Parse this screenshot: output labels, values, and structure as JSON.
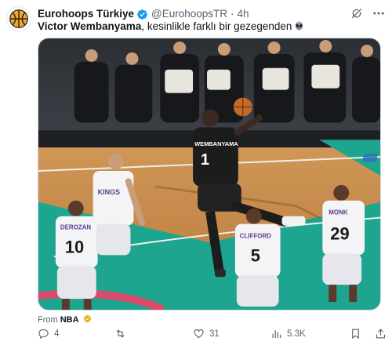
{
  "colors": {
    "verified": "#1d9bf0",
    "text_primary": "#0f1419",
    "text_secondary": "#536471",
    "court_teal": "#1ea58f",
    "court_wood": "#c98b4a",
    "spurs_black": "#1c1c1c",
    "kings_purple": "#5b3d8f"
  },
  "post": {
    "author": {
      "display_name": "Eurohoops Türkiye",
      "handle": "@EurohoopsTR",
      "separator": "·",
      "timestamp": "4h",
      "verified": true,
      "avatar_icon": "eurohoops-logo"
    },
    "text": {
      "mention": "Victor Wembanyama",
      "body": ", kesinlikle farklı bir gezegenden",
      "emoji_icon": "alien-icon"
    },
    "media": {
      "type": "video",
      "jersey_numbers": [
        "1",
        "10",
        "5",
        "29"
      ],
      "jersey_names": [
        "WEMBANYAMA",
        "DEROZAN",
        "CLIFFORD",
        "MONK"
      ],
      "jersey_team": "KINGS"
    },
    "source": {
      "prefix": "From",
      "org": "NBA",
      "badge_icon": "gold-verified-icon"
    },
    "actions": {
      "reply_count": "4",
      "repost_count": "",
      "like_count": "31",
      "views_count": "5.3K"
    },
    "icons": {
      "grok": "grok-icon",
      "more": "more-icon",
      "reply": "reply-icon",
      "repost": "repost-icon",
      "like": "heart-icon",
      "views": "views-icon",
      "bookmark": "bookmark-icon",
      "share": "share-icon"
    }
  }
}
